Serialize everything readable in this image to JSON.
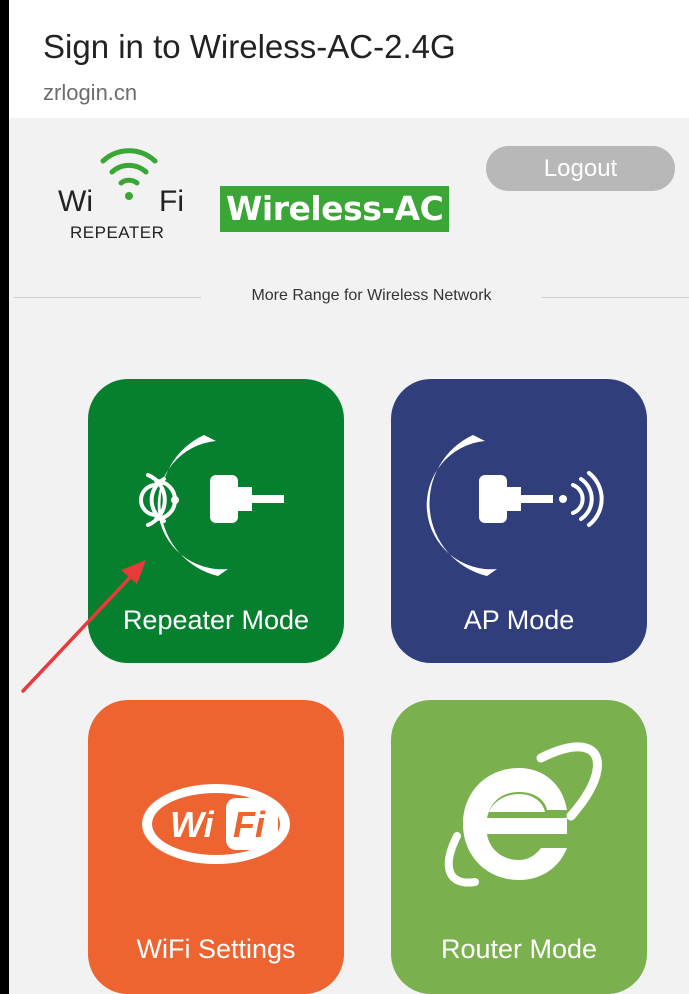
{
  "header": {
    "title": "Sign in to Wireless-AC-2.4G",
    "url": "zrlogin.cn"
  },
  "logo": {
    "wi": "Wi",
    "fi": "Fi",
    "subtitle": "REPEATER"
  },
  "brand": "Wireless-AC",
  "logout_label": "Logout",
  "tagline": "More Range for Wireless Network",
  "tiles": [
    {
      "label": "Repeater Mode",
      "icon": "repeater-icon",
      "color": "#067f2f"
    },
    {
      "label": "AP Mode",
      "icon": "ap-icon",
      "color": "#303f7c"
    },
    {
      "label": "WiFi Settings",
      "icon": "wifi-logo-icon",
      "color": "#ee6431"
    },
    {
      "label": "Router Mode",
      "icon": "internet-explorer-icon",
      "color": "#7ab04d"
    }
  ],
  "wifi_icon": {
    "wi": "Wi",
    "fi": "Fi"
  },
  "colors": {
    "brand_green": "#3aa635",
    "annotation_arrow": "#e83a3a"
  }
}
